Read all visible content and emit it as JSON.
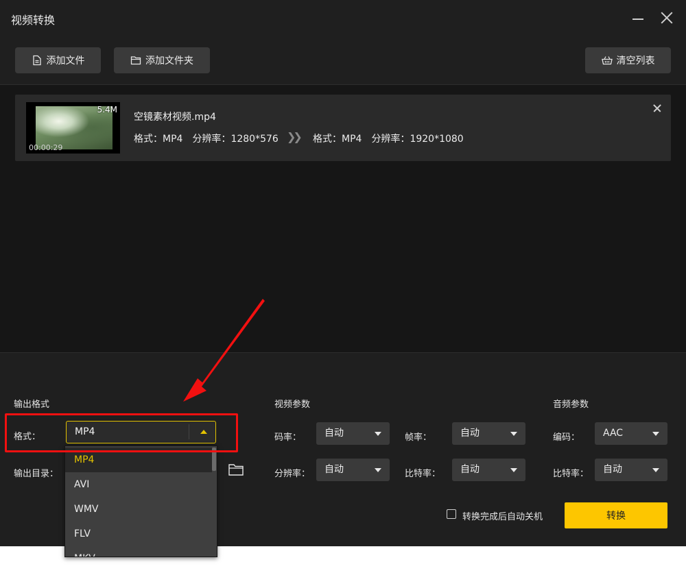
{
  "window": {
    "title": "视频转换"
  },
  "toolbar": {
    "add_file": "添加文件",
    "add_folder": "添加文件夹",
    "clear_list": "清空列表"
  },
  "file": {
    "name": "空镜素材视频.mp4",
    "size": "5.4M",
    "duration": "00:00:29",
    "source": {
      "format_label": "格式：",
      "format": "MP4",
      "resolution_label": "分辨率：",
      "resolution": "1280*576"
    },
    "target": {
      "format_label": "格式：",
      "format": "MP4",
      "resolution_label": "分辨率：",
      "resolution": "1920*1080"
    }
  },
  "output": {
    "section_title": "输出格式",
    "format_label": "格式：",
    "format_value": "MP4",
    "dir_label": "输出目录："
  },
  "video_params": {
    "section_title": "视频参数",
    "bitrate_label": "码率：",
    "bitrate": "自动",
    "framerate_label": "帧率：",
    "framerate": "自动",
    "resolution_label": "分辨率：",
    "resolution": "自动",
    "bit_rate_label": "比特率：",
    "bit_rate": "自动"
  },
  "audio_params": {
    "section_title": "音频参数",
    "codec_label": "编码：",
    "codec": "AAC",
    "bitrate_label": "比特率：",
    "bitrate": "自动"
  },
  "footer": {
    "shutdown_label": "转换完成后自动关机",
    "shutdown_checked": false,
    "convert_button": "转换"
  },
  "format_dropdown": {
    "options": [
      "MP4",
      "AVI",
      "WMV",
      "FLV",
      "MKV"
    ],
    "selected": "MP4"
  },
  "colors": {
    "accent": "#fdc600",
    "annotation": "#f21010"
  }
}
